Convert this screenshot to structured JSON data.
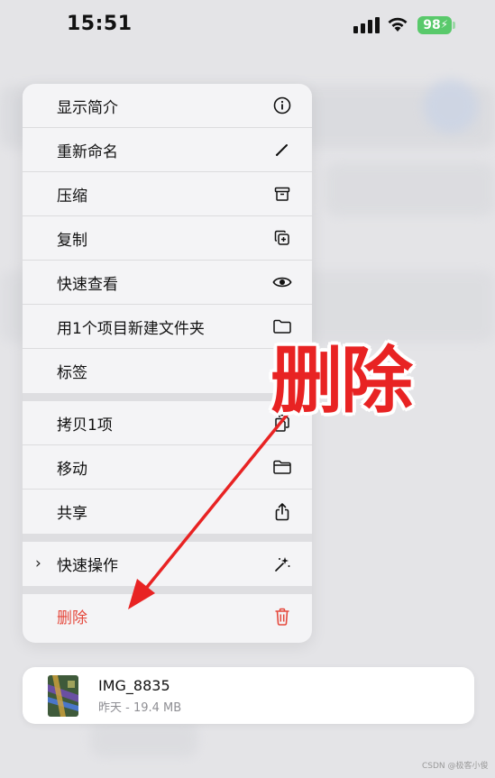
{
  "status_bar": {
    "time": "15:51",
    "battery": "98"
  },
  "menu": {
    "items": [
      {
        "label": "显示简介",
        "icon": "info-icon"
      },
      {
        "label": "重新命名",
        "icon": "pencil-icon"
      },
      {
        "label": "压缩",
        "icon": "archive-box-icon"
      },
      {
        "label": "复制",
        "icon": "duplicate-icon"
      },
      {
        "label": "快速查看",
        "icon": "eye-icon"
      },
      {
        "label": "用1个项目新建文件夹",
        "icon": "new-folder-icon"
      },
      {
        "label": "标签",
        "icon": "tag-icon"
      },
      {
        "label": "拷贝1项",
        "icon": "copy-doc-icon"
      },
      {
        "label": "移动",
        "icon": "folder-icon"
      },
      {
        "label": "共享",
        "icon": "share-icon"
      },
      {
        "label": "快速操作",
        "icon": "sparkles-icon"
      },
      {
        "label": "删除",
        "icon": "trash-icon"
      }
    ]
  },
  "file": {
    "name": "IMG_8835",
    "meta": "昨天 - 19.4 MB"
  },
  "annotation": {
    "text": "删除"
  },
  "watermark": "CSDN @极客小俊",
  "colors": {
    "danger": "#e5483c",
    "battery": "#59c96b",
    "annotation": "#e82323"
  }
}
